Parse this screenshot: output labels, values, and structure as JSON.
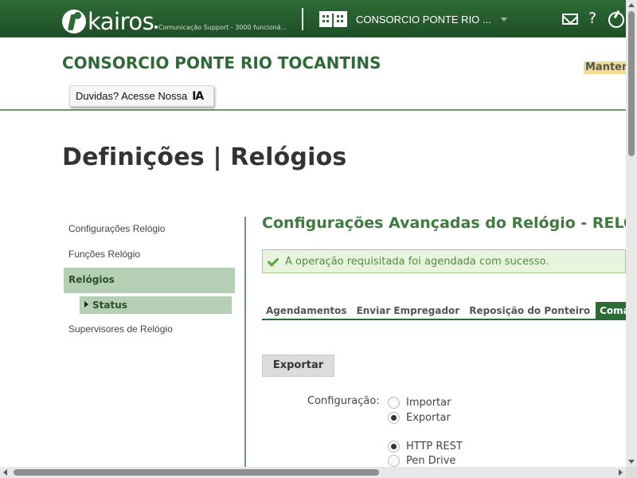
{
  "topbar": {
    "logo_text": "kairos",
    "company_sub": "Comunicação Support - 3000 funcioná...",
    "company_select": "CONSORCIO PONTE RIO ...",
    "icons": {
      "mail": "mail-icon",
      "help": "?",
      "power": "power-icon"
    }
  },
  "header": {
    "company_title": "CONSORCIO PONTE RIO TOCANTINS",
    "maintenance_badge": "Manten",
    "ia_button_label": "Duvidas? Acesse Nossa",
    "ia_icon_text": "IA"
  },
  "page": {
    "title": "Definições | Relógios"
  },
  "sidebar": {
    "items": [
      {
        "label": "Configurações Relógio"
      },
      {
        "label": "Funções Relógio"
      },
      {
        "label": "Relógios"
      },
      {
        "label": "Supervisores de Relógio"
      }
    ],
    "sub_item": {
      "label": "Status"
    }
  },
  "main": {
    "section_title": "Configurações Avançadas do Relógio - RELO",
    "success_message": "A operação requisitada foi agendada com sucesso.",
    "tabs": [
      {
        "label": "Agendamentos"
      },
      {
        "label": "Enviar Empregador"
      },
      {
        "label": "Reposição do Ponteiro"
      },
      {
        "label": "Comandos d"
      }
    ],
    "export_button": "Exportar",
    "config_label": "Configuração:",
    "config_options": [
      {
        "label": "Importar",
        "checked": false
      },
      {
        "label": "Exportar",
        "checked": true
      }
    ],
    "transport_options": [
      {
        "label": "HTTP REST",
        "checked": true
      },
      {
        "label": "Pen Drive",
        "checked": false
      }
    ]
  },
  "colors": {
    "brand_green": "#2e6a36",
    "title_green": "#3f7a3f",
    "nav_active_bg": "#b5cfb5",
    "success_bg": "#e9f4df",
    "badge_yellow": "#f0dc95"
  }
}
